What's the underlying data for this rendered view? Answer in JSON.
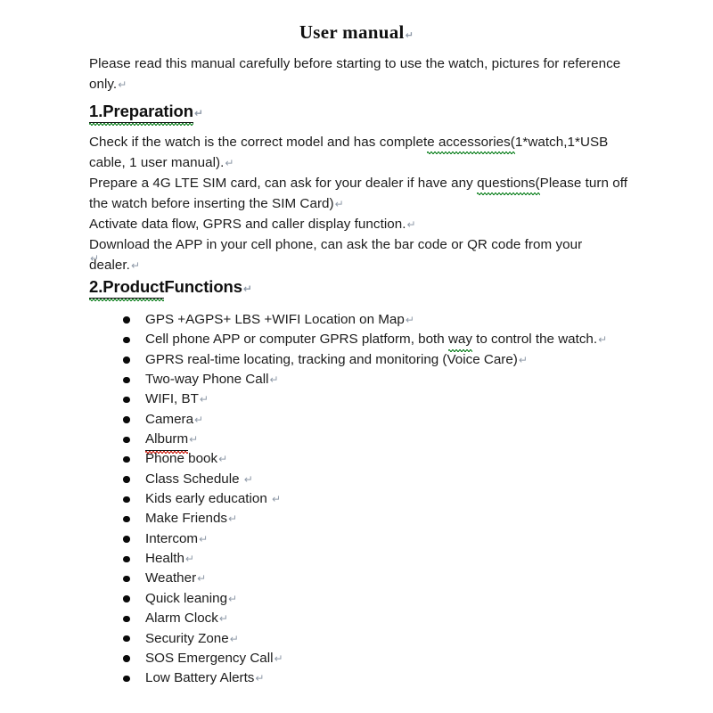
{
  "document": {
    "title": "User manual",
    "paragraph_mark": "↵",
    "intro": {
      "line1": "Please read this manual carefully before starting to use the watch, pictures for reference",
      "line2": "only."
    },
    "sections": [
      {
        "number": "1.",
        "name": "Preparation",
        "heading_underlined_part": "1.Preparation",
        "heading_rest": "",
        "paragraphs": [
          {
            "pre": "Check if the watch is the correct model and has complet",
            "flagged": "e accessories(",
            "post": "1*watch,1*USB",
            "line2": "cable, 1 user manual)."
          },
          {
            "pre": "Prepare a 4G LTE SIM card, can ask for your dealer if have any ",
            "flagged": "questions(",
            "post": "Please turn off",
            "line2": "the watch before inserting the SIM Card)"
          },
          {
            "text": "Activate data flow, GPRS and caller display function."
          },
          {
            "text": "Download the APP in your cell phone, can ask the bar code or QR code from your dealer."
          }
        ]
      },
      {
        "number": "2.",
        "name": "Product Functions",
        "heading_underlined_part": "2.Product",
        "heading_rest": " Functions",
        "items": [
          {
            "text": "GPS +AGPS+ LBS +WIFI Location on Map",
            "flag": "none"
          },
          {
            "pre": "Cell phone APP or computer GPRS platform, both ",
            "flagged": "way",
            "post": " to control the watch.",
            "flag": "grammar"
          },
          {
            "text": "GPRS real-time locating, tracking and monitoring (Voice Care)",
            "flag": "none"
          },
          {
            "text": "Two-way Phone Call",
            "flag": "none"
          },
          {
            "text": "WIFI, BT",
            "flag": "none"
          },
          {
            "text": "Camera",
            "flag": "none"
          },
          {
            "text": "Alburm",
            "flag": "spelling"
          },
          {
            "text": "Phone book",
            "flag": "none"
          },
          {
            "text": "Class Schedule ",
            "flag": "none"
          },
          {
            "text": "Kids early education ",
            "flag": "none"
          },
          {
            "text": "Make Friends",
            "flag": "none"
          },
          {
            "text": "Intercom",
            "flag": "none"
          },
          {
            "text": "Health",
            "flag": "none"
          },
          {
            "text": "Weather",
            "flag": "none"
          },
          {
            "text": "Quick leaning",
            "flag": "none"
          },
          {
            "text": "Alarm Clock",
            "flag": "none"
          },
          {
            "text": "Security Zone",
            "flag": "none"
          },
          {
            "text": "SOS Emergency Call",
            "flag": "none"
          },
          {
            "text": "Low Battery Alerts",
            "flag": "none"
          }
        ]
      }
    ],
    "colors": {
      "text": "#1c1c1c",
      "spelling_squiggle": "#d02b1f",
      "grammar_squiggle": "#1f8a2f",
      "paragraph_mark": "#8f9aa8",
      "background": "#ffffff"
    }
  }
}
